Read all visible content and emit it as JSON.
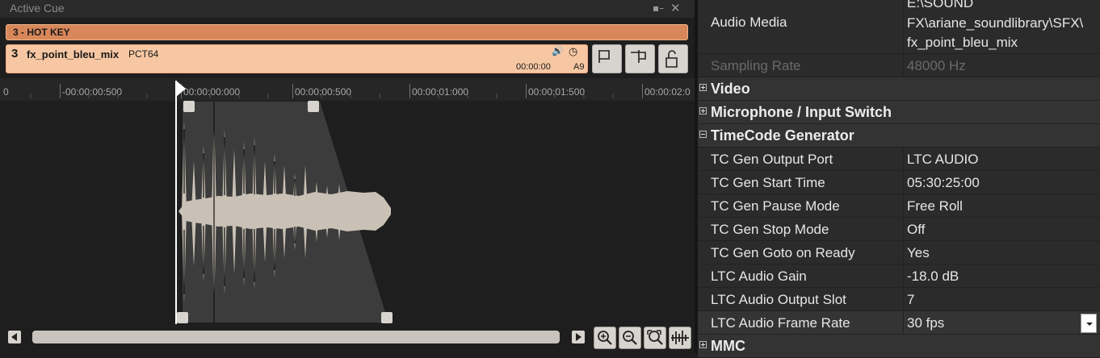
{
  "active_cue": {
    "title": "Active Cue",
    "hotkey_label": "3 - HOT KEY",
    "cue": {
      "number": "3",
      "name": "fx_point_bleu_mix",
      "tag": "PCT64",
      "time": "00:00:00",
      "slot": "A9"
    },
    "ruler_labels": [
      "0",
      "-00:00:00:500",
      "00:00:00:000",
      "00:00:00:500",
      "00:00:01:000",
      "00:00:01:500",
      "00:00:02:0"
    ]
  },
  "properties": {
    "audio_media_key": "Audio Media",
    "audio_media_lines": [
      "E:\\SOUND",
      "FX\\ariane_soundlibrary\\SFX\\",
      "fx_point_bleu_mix"
    ],
    "sampling_rate_key": "Sampling Rate",
    "sampling_rate_val": "48000 Hz",
    "categories": {
      "video": "Video",
      "mic": "Microphone / Input Switch",
      "tc": "TimeCode Generator",
      "mmc": "MMC"
    },
    "rows": [
      {
        "k": "TC Gen Output Port",
        "v": "LTC AUDIO"
      },
      {
        "k": "TC Gen Start Time",
        "v": "05:30:25:00"
      },
      {
        "k": "TC Gen Pause Mode",
        "v": "Free Roll"
      },
      {
        "k": "TC Gen Stop Mode",
        "v": "Off"
      },
      {
        "k": "TC Gen Goto on Ready",
        "v": "Yes"
      },
      {
        "k": "LTC Audio Gain",
        "v": "-18.0 dB"
      },
      {
        "k": "LTC Audio Output Slot",
        "v": "7"
      },
      {
        "k": "LTC Audio Frame Rate",
        "v": "30 fps"
      }
    ]
  },
  "colors": {
    "hotkey": "#d8875a",
    "cue": "#f7c7a3",
    "waveform": "#c9c1b5"
  },
  "icons": [
    "pin-icon",
    "close-icon",
    "speaker-icon",
    "clock-icon",
    "set-in-icon",
    "set-out-icon",
    "unlock-icon",
    "zoom-in-icon",
    "zoom-out-icon",
    "zoom-fit-icon",
    "waveform-icon"
  ]
}
